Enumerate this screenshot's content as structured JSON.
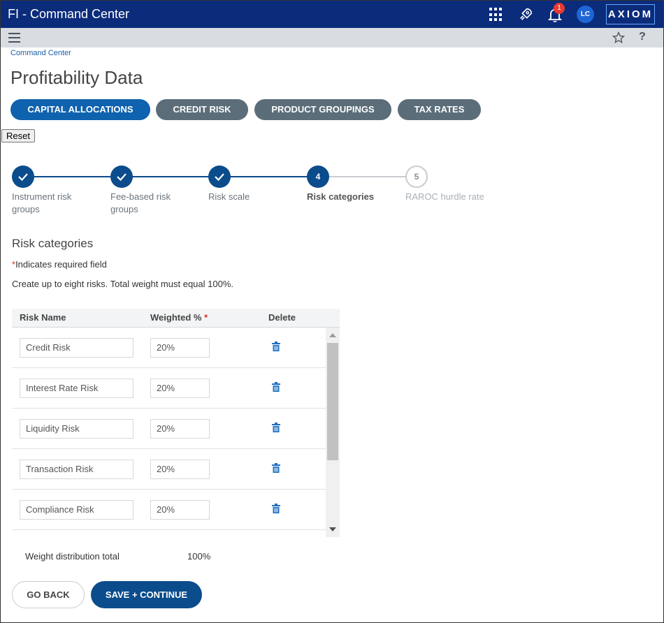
{
  "header": {
    "title": "FI - Command Center",
    "notification_count": "1",
    "avatar_initials": "LC",
    "logo_text": "AXIOM",
    "colors": {
      "bar": "#0b2b7b",
      "badge": "#e83a2f",
      "avatar": "#1e66d6"
    }
  },
  "subbar": {
    "help_label": "?"
  },
  "breadcrumb": "Command Center",
  "page_title": "Profitability Data",
  "tabs": [
    {
      "label": "CAPITAL ALLOCATIONS",
      "active": true
    },
    {
      "label": "CREDIT RISK",
      "active": false
    },
    {
      "label": "PRODUCT GROUPINGS",
      "active": false
    },
    {
      "label": "TAX RATES",
      "active": false
    }
  ],
  "reset_label": "Reset",
  "stepper": [
    {
      "number": "1",
      "label": "Instrument risk groups",
      "status": "done"
    },
    {
      "number": "2",
      "label": "Fee-based risk groups",
      "status": "done"
    },
    {
      "number": "3",
      "label": "Risk scale",
      "status": "done"
    },
    {
      "number": "4",
      "label": "Risk categories",
      "status": "current"
    },
    {
      "number": "5",
      "label": "RAROC hurdle rate",
      "status": "future"
    }
  ],
  "section": {
    "title": "Risk categories",
    "required_asterisk": "*",
    "required_text": "Indicates required field",
    "instructions": "Create up to eight risks. Total weight must equal 100%."
  },
  "table": {
    "headers": {
      "name": "Risk Name",
      "weight": "Weighted %",
      "weight_required": "*",
      "delete": "Delete"
    },
    "rows": [
      {
        "name": "Credit Risk",
        "weight": "20%"
      },
      {
        "name": "Interest Rate Risk",
        "weight": "20%"
      },
      {
        "name": "Liquidity Risk",
        "weight": "20%"
      },
      {
        "name": "Transaction Risk",
        "weight": "20%"
      },
      {
        "name": "Compliance Risk",
        "weight": "20%"
      }
    ]
  },
  "totals": {
    "label": "Weight distribution total",
    "value": "100%"
  },
  "footer": {
    "back_label": "GO BACK",
    "save_label": "SAVE + CONTINUE"
  },
  "colors": {
    "primary": "#0b4c8c",
    "tab_active": "#0f62ae",
    "tab_inactive": "#5b6d79",
    "required": "#d7342c"
  }
}
